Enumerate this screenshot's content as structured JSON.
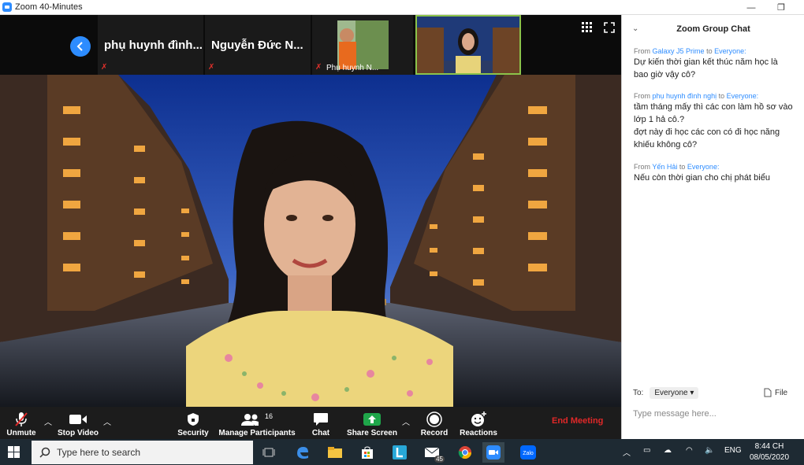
{
  "window": {
    "title": "Zoom 40-Minutes",
    "minimize_glyph": "—",
    "restore_glyph": "❐"
  },
  "thumbnails": [
    {
      "name": "phụ huynh đình...",
      "muted": true
    },
    {
      "name": "Nguyễn Đức N...",
      "muted": true
    },
    {
      "name": "Phụ huynh N...",
      "muted": true
    },
    {
      "name": "",
      "muted": false
    }
  ],
  "toolbar": {
    "unmute": "Unmute",
    "stop_video": "Stop Video",
    "security": "Security",
    "manage_participants": "Manage Participants",
    "participant_count": "16",
    "chat": "Chat",
    "share_screen": "Share Screen",
    "record": "Record",
    "reactions": "Reactions",
    "end_meeting": "End Meeting"
  },
  "chat": {
    "title": "Zoom Group Chat",
    "messages": [
      {
        "from_prefix": "From",
        "sender": "Galaxy J5 Prime",
        "to_word": "to",
        "recipient": "Everyone:",
        "lines": [
          "Dự kiến thời gian kết thúc năm học là",
          "bao giờ vậy cô?"
        ]
      },
      {
        "from_prefix": "From",
        "sender": "phụ huynh đình nghị",
        "to_word": "to",
        "recipient": "Everyone:",
        "lines": [
          "tầm tháng mấy thì các con làm hồ sơ vào",
          "lớp 1 hả cô.?",
          "đợt này đi học các con có đi học năng",
          "khiếu không cô?"
        ]
      },
      {
        "from_prefix": "From",
        "sender": "Yến Hải",
        "to_word": "to",
        "recipient": "Everyone:",
        "lines": [
          "Nếu còn thời gian cho chị phát biểu"
        ]
      }
    ],
    "to_label": "To:",
    "to_value": "Everyone",
    "file_label": "File",
    "input_placeholder": "Type message here..."
  },
  "taskbar": {
    "search_placeholder": "Type here to search",
    "mail_badge": "45",
    "language": "ENG",
    "time": "8:44 CH",
    "date": "08/05/2020"
  },
  "colors": {
    "accent": "#2d8cff",
    "end_meeting": "#e02828",
    "share_green": "#1fa64a",
    "toolbar_bg": "#1c1c1c",
    "taskbar_bg": "#1e2a33"
  }
}
